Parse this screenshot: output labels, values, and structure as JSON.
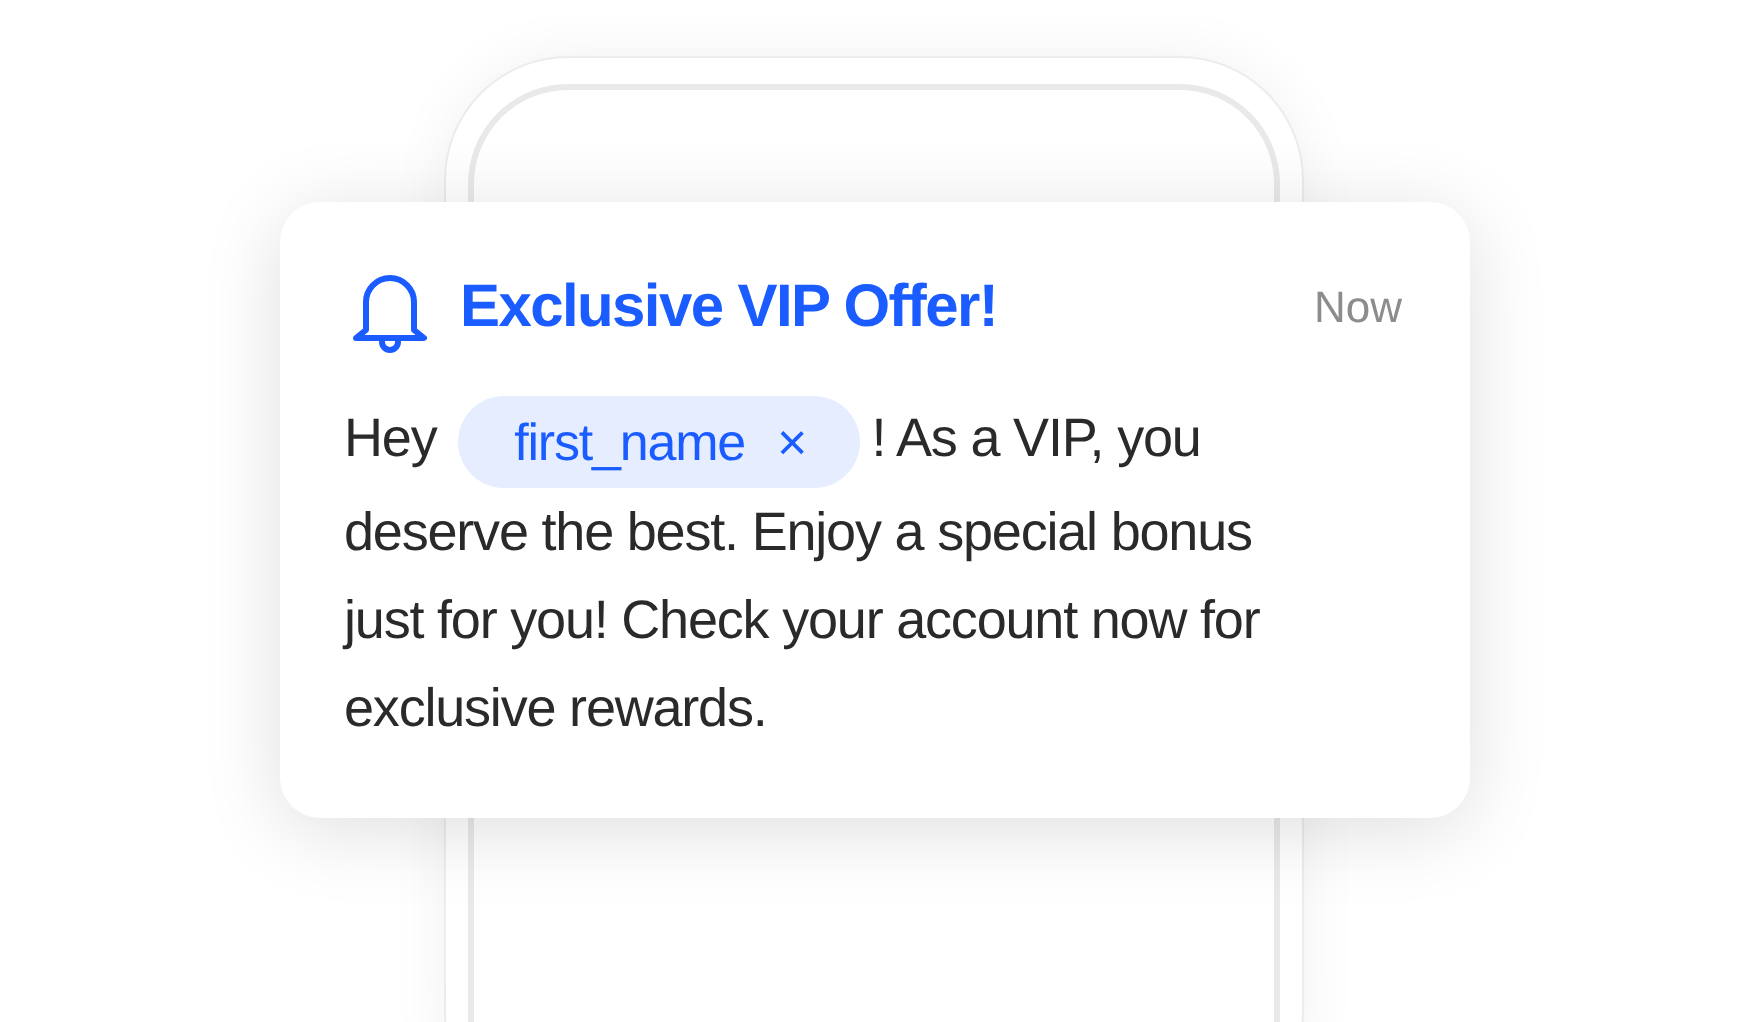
{
  "notification": {
    "title": "Exclusive VIP Offer!",
    "time": "Now",
    "message": {
      "before": "Hey",
      "chip": {
        "label": "first_name",
        "remove": "×"
      },
      "after": "! As a VIP, you deserve the best. Enjoy a special bonus just for you! Check your account now for exclusive rewards."
    }
  }
}
